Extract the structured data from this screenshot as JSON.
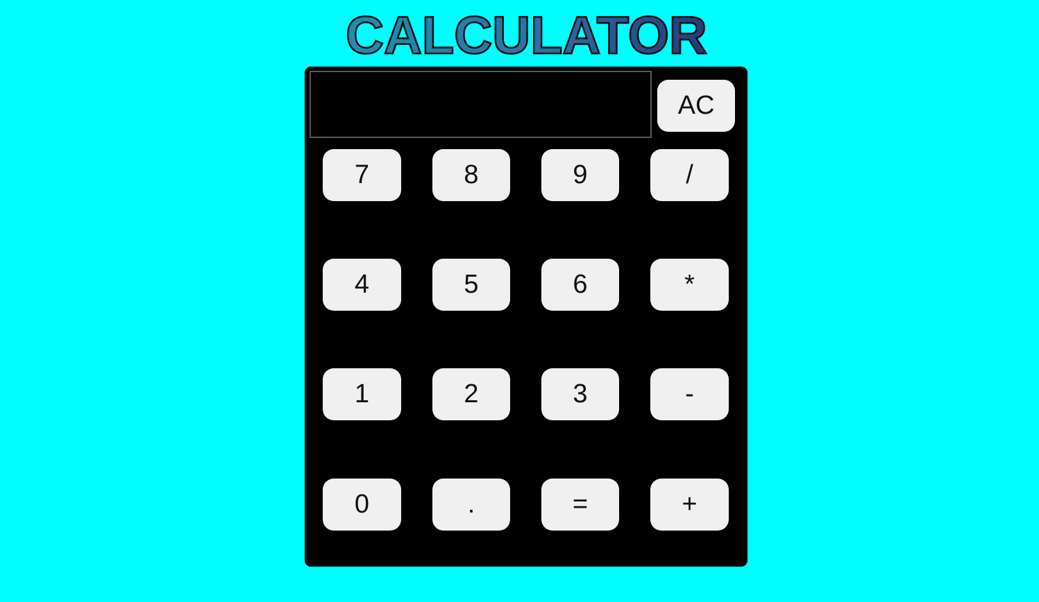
{
  "header": {
    "title": "CALCULATOR"
  },
  "display": {
    "value": ""
  },
  "buttons": {
    "clear": "AC",
    "row1": [
      "7",
      "8",
      "9",
      "/"
    ],
    "row2": [
      "4",
      "5",
      "6",
      "*"
    ],
    "row3": [
      "1",
      "2",
      "3",
      "-"
    ],
    "row4": [
      "0",
      ".",
      "=",
      "+"
    ]
  },
  "colors": {
    "page_background": "#00ffff",
    "calculator_body": "#000000",
    "button_face": "#f0f0f0",
    "title_gradient_start": "#1f8fb0",
    "title_gradient_end": "#243a7a"
  }
}
